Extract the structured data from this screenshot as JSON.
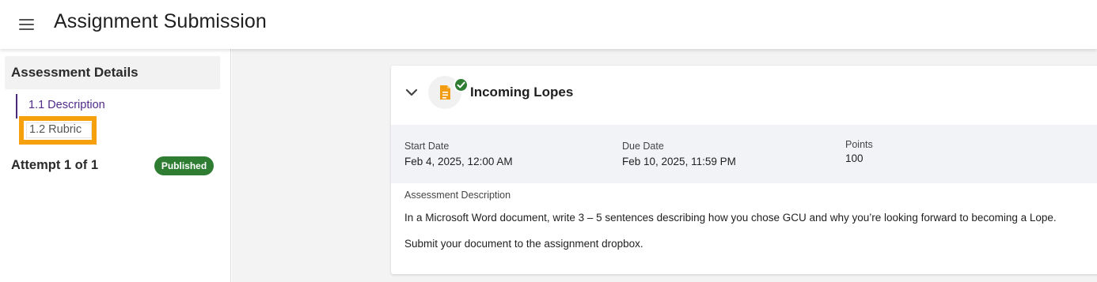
{
  "header": {
    "title": "Assignment Submission",
    "menu_icon": "hamburger-menu-icon"
  },
  "sidebar": {
    "section_title": "Assessment Details",
    "items": [
      {
        "label": "1.1 Description",
        "state": "active"
      },
      {
        "label": "1.2 Rubric",
        "state": "highlighted"
      }
    ],
    "attempt_label": "Attempt 1 of 1",
    "status_badge": "Published",
    "colors": {
      "active_nav": "#512a8a",
      "highlight": "#f5a00c",
      "badge_bg": "#2e7d32"
    }
  },
  "card": {
    "title": "Incoming Lopes",
    "icons": [
      "chevron-down-icon",
      "document-icon",
      "check-circle-icon"
    ],
    "meta": [
      {
        "label": "Start Date",
        "value": "Feb 4, 2025, 12:00 AM"
      },
      {
        "label": "Due Date",
        "value": "Feb 10, 2025, 11:59 PM"
      },
      {
        "label": "Points",
        "value": "100"
      }
    ],
    "description_label": "Assessment Description",
    "description_paragraphs": [
      "In a Microsoft Word document, write 3 – 5 sentences describing how you chose GCU and why you’re looking forward to becoming a Lope.",
      "Submit your document to the assignment dropbox."
    ],
    "colors": {
      "doc_icon": "#f39c12",
      "check": "#2e7d32"
    }
  }
}
